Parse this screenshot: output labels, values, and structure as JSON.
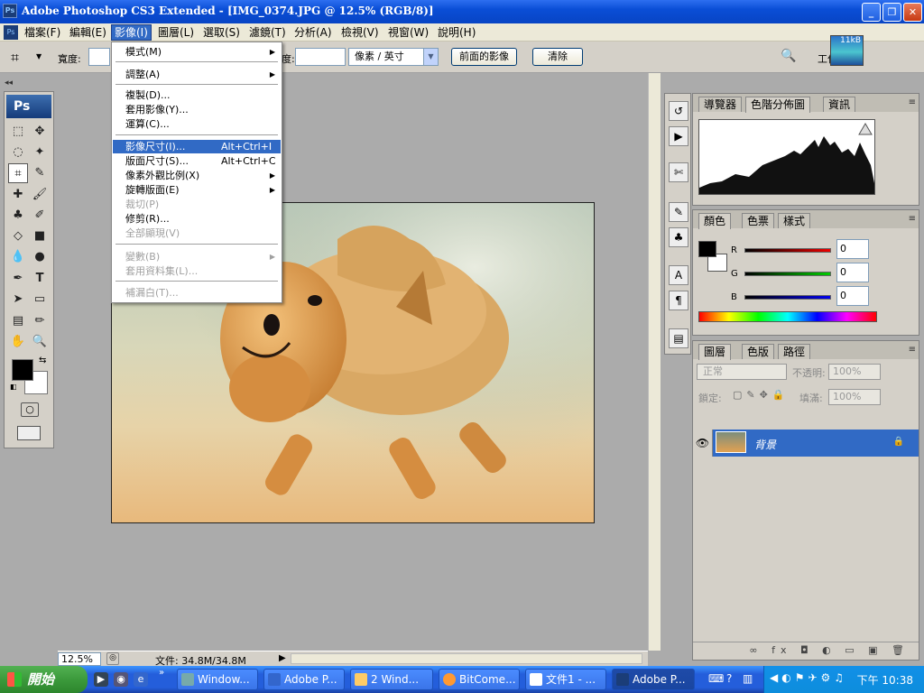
{
  "window": {
    "app_icon": "Ps",
    "title": "Adobe Photoshop CS3 Extended - [IMG_0374.JPG @ 12.5% (RGB/8)]",
    "btn_min": "_",
    "btn_max": "❐",
    "btn_close": "✕"
  },
  "menubar": {
    "items": [
      "檔案(F)",
      "編輯(E)",
      "影像(I)",
      "圖層(L)",
      "選取(S)",
      "濾鏡(T)",
      "分析(A)",
      "檢視(V)",
      "視窗(W)",
      "說明(H)"
    ],
    "mdi": [
      "-",
      "❐",
      "×"
    ]
  },
  "options": {
    "width_label": "寬度:",
    "height_label": "度:",
    "units": "像素 / 英寸",
    "front_image": "前面的影像",
    "clear": "清除",
    "workspace_label": "工作",
    "size_badge": "11kB"
  },
  "image_menu": {
    "items": [
      {
        "label": "模式(M)",
        "shortcut": "",
        "submenu": true,
        "disabled": false
      },
      {
        "label": "調整(A)",
        "shortcut": "",
        "submenu": true,
        "disabled": false
      },
      {
        "label": "複製(D)...",
        "shortcut": "",
        "submenu": false,
        "disabled": false
      },
      {
        "label": "套用影像(Y)...",
        "shortcut": "",
        "submenu": false,
        "disabled": false
      },
      {
        "label": "運算(C)...",
        "shortcut": "",
        "submenu": false,
        "disabled": false
      },
      {
        "label": "影像尺寸(I)...",
        "shortcut": "Alt+Ctrl+I",
        "submenu": false,
        "disabled": false,
        "highlighted": true
      },
      {
        "label": "版面尺寸(S)...",
        "shortcut": "Alt+Ctrl+C",
        "submenu": false,
        "disabled": false
      },
      {
        "label": "像素外觀比例(X)",
        "shortcut": "",
        "submenu": true,
        "disabled": false
      },
      {
        "label": "旋轉版面(E)",
        "shortcut": "",
        "submenu": true,
        "disabled": false
      },
      {
        "label": "裁切(P)",
        "shortcut": "",
        "submenu": false,
        "disabled": true
      },
      {
        "label": "修剪(R)...",
        "shortcut": "",
        "submenu": false,
        "disabled": false
      },
      {
        "label": "全部顯現(V)",
        "shortcut": "",
        "submenu": false,
        "disabled": true
      },
      {
        "label": "變數(B)",
        "shortcut": "",
        "submenu": true,
        "disabled": true
      },
      {
        "label": "套用資料集(L)...",
        "shortcut": "",
        "submenu": false,
        "disabled": true
      },
      {
        "label": "補漏白(T)...",
        "shortcut": "",
        "submenu": false,
        "disabled": true
      }
    ]
  },
  "status": {
    "zoom": "12.5%",
    "doc": "文件: 34.8M/34.8M"
  },
  "panels": {
    "histogram_tabs": [
      "導覽器",
      "色階分佈圖",
      "資訊"
    ],
    "color_tabs": [
      "顏色",
      "色票",
      "樣式"
    ],
    "color": {
      "r_label": "R",
      "g_label": "G",
      "b_label": "B",
      "r": "0",
      "g": "0",
      "b": "0"
    },
    "layers_tabs": [
      "圖層",
      "色版",
      "路徑"
    ],
    "blend_mode": "正常",
    "opacity_label": "不透明:",
    "opacity": "100%",
    "lock_label": "鎖定:",
    "fill_label": "填滿:",
    "fill": "100%",
    "layer_name": "背景",
    "footer": "∞ fx ◘ ◐ ▭ ▣ 🗑"
  },
  "taskbar": {
    "start": "開始",
    "tasks": [
      "Window...",
      "Adobe P...",
      "2 Wind...",
      "BitCome...",
      "文件1 - ...",
      "Adobe P..."
    ],
    "clock": "下午 10:38"
  },
  "colors": {
    "menu_highlight": "#316ac5",
    "titlebar": "#0a4ed6",
    "taskbar": "#245edb"
  }
}
